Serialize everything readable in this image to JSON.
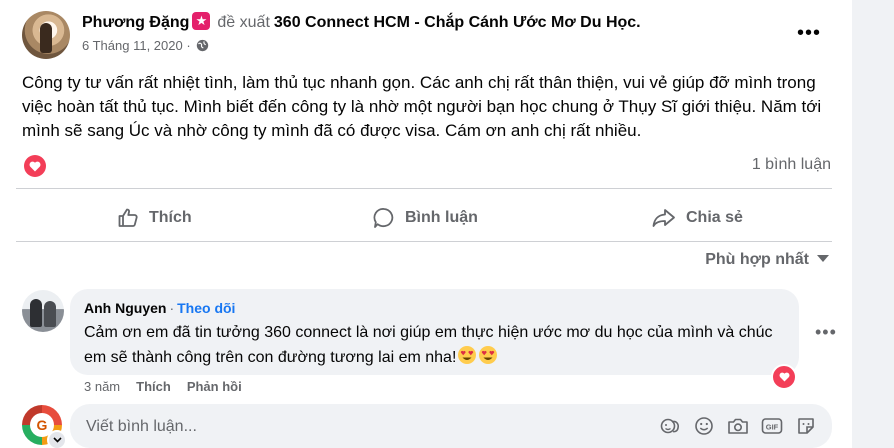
{
  "post": {
    "author": "Phương Đặng",
    "verb": "đề xuất",
    "page": "360 Connect HCM - Chắp Cánh Ước Mơ Du Học.",
    "date": "6 Tháng 11, 2020",
    "separator": "·",
    "menu": "•••",
    "text": "Công ty tư vấn rất nhiệt tình, làm thủ tục nhanh gọn. Các anh chị rất thân thiện, vui vẻ giúp đỡ mình trong việc hoàn tất thủ tục. Mình biết đến công ty là nhờ một người bạn học chung ở Thụy Sĩ giới thiệu. Năm tới mình sẽ sang Úc và nhờ công ty mình đã có được visa. Cám ơn anh chị rất nhiều.",
    "reaction_icon": "heart-icon",
    "comment_count": "1 bình luận"
  },
  "actions": {
    "like": "Thích",
    "comment": "Bình luận",
    "share": "Chia sẻ"
  },
  "sort_label": "Phù hợp nhất",
  "comment": {
    "name": "Anh Nguyen",
    "separator": "·",
    "follow": "Theo dõi",
    "text": "Cảm ơn em đã tin tưởng 360 connect là nơi giúp em thực hiện ước mơ du học của mình và chúc em sẽ thành công trên con đường tương lai em nha!",
    "emoji": "heart-eyes-emoji",
    "time": "3 năm",
    "like": "Thích",
    "reply": "Phản hồi",
    "menu": "•••",
    "reaction_icon": "heart-icon"
  },
  "write": {
    "placeholder": "Viết bình luận...",
    "tools": [
      "sticker-face-icon",
      "emoji-icon",
      "camera-icon",
      "gif-icon",
      "sticker-icon"
    ]
  },
  "colors": {
    "accent": "#1877f2",
    "secondary_text": "#65676b",
    "love": "#f33e58",
    "badge": "#e4206b",
    "bubble": "#f0f2f5"
  }
}
